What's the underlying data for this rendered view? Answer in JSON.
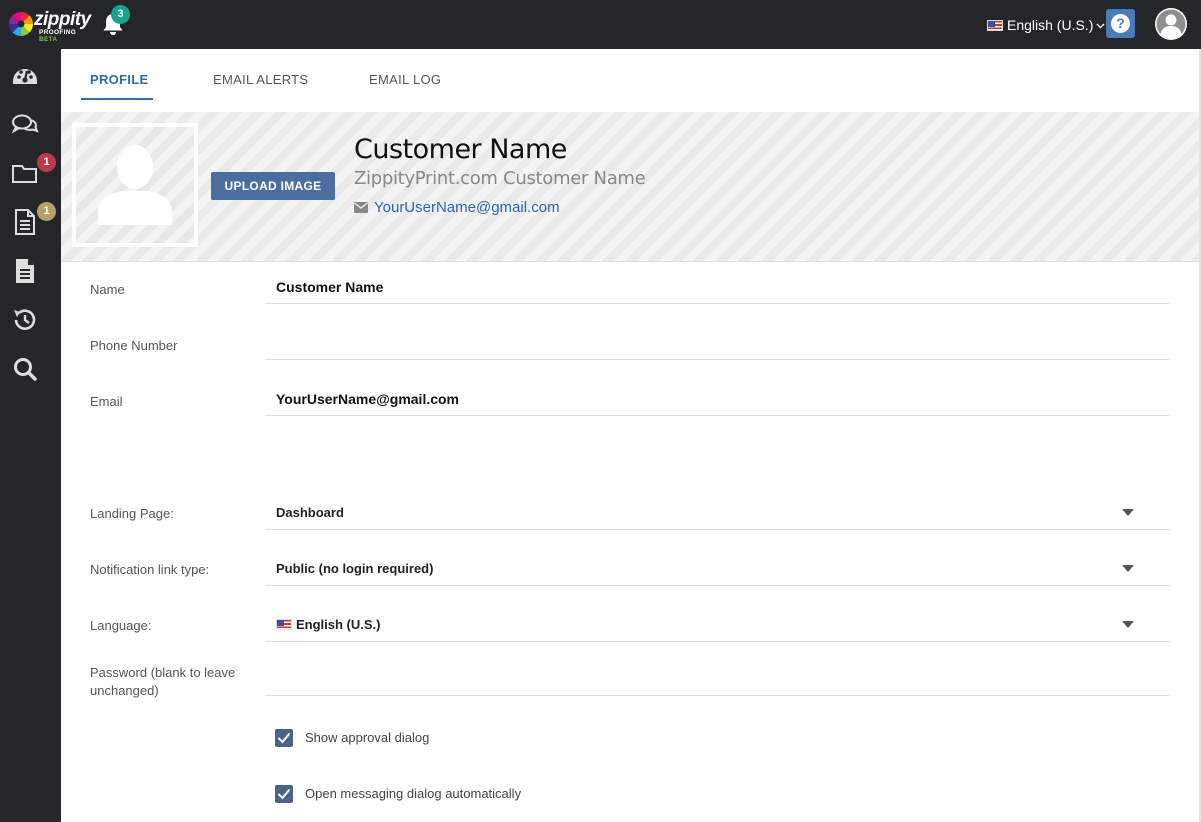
{
  "app": {
    "logo_text": "zippity",
    "logo_sub": "PROOFING",
    "logo_beta": "BETA",
    "notifications_count": "3",
    "language_label": "English (U.S.)",
    "help_label": "?"
  },
  "sidebar": {
    "items": [
      {
        "icon": "dashboard-icon"
      },
      {
        "icon": "messages-icon"
      },
      {
        "icon": "folder-icon",
        "badge": "1",
        "badge_color": "#c0394b"
      },
      {
        "icon": "document-icon",
        "badge": "1",
        "badge_color": "#b5a067"
      },
      {
        "icon": "file-text-icon"
      },
      {
        "icon": "history-icon"
      },
      {
        "icon": "search-icon"
      }
    ]
  },
  "tabs": [
    {
      "label": "PROFILE",
      "active": true
    },
    {
      "label": "EMAIL ALERTS",
      "active": false
    },
    {
      "label": "EMAIL LOG",
      "active": false
    }
  ],
  "profile": {
    "upload_label": "UPLOAD IMAGE",
    "name": "Customer Name",
    "company": "ZippityPrint.com Customer Name",
    "email": "YourUserName@gmail.com"
  },
  "form": {
    "name_label": "Name",
    "name_value": "Customer Name",
    "phone_label": "Phone Number",
    "phone_value": "",
    "email_label": "Email",
    "email_value": "YourUserName@gmail.com",
    "landing_label": "Landing Page:",
    "landing_value": "Dashboard",
    "notif_label": "Notification link type:",
    "notif_value": "Public (no login required)",
    "language_label": "Language:",
    "language_value": "English (U.S.)",
    "password_label": "Password (blank to leave unchanged)",
    "password_value": "",
    "checkbox_approval_label": "Show approval dialog",
    "checkbox_approval_checked": true,
    "checkbox_messaging_label": "Open messaging dialog automatically",
    "checkbox_messaging_checked": true
  },
  "colors": {
    "accent": "#2f6ea5",
    "topbar": "#25262a",
    "upload_button": "#4a6ea0",
    "help_button": "#4c7bbc",
    "notification_badge": "#17a38f"
  }
}
